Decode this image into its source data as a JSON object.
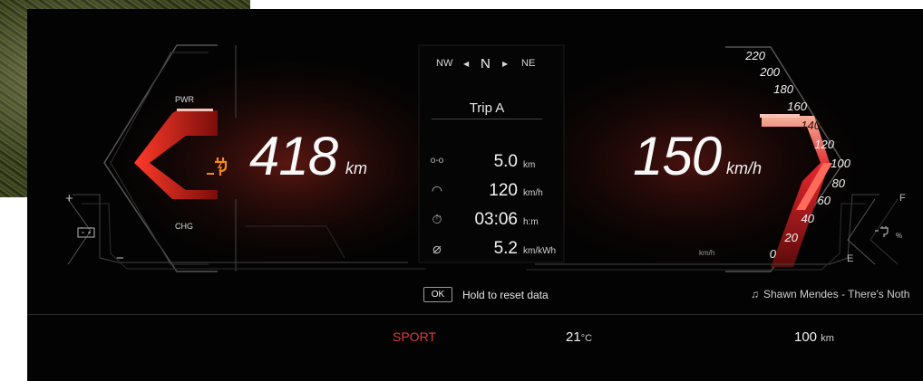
{
  "compass": {
    "left": "NW",
    "left_arrow": "◀",
    "heading": "N",
    "right_arrow": "▶",
    "right": "NE"
  },
  "trip": {
    "title": "Trip A",
    "rows": [
      {
        "icon": "distance-icon",
        "glyph": "o-o",
        "value": "5.0",
        "unit": "km"
      },
      {
        "icon": "speedometer-icon",
        "glyph": "◠",
        "value": "120",
        "unit": "km/h"
      },
      {
        "icon": "stopwatch-icon",
        "glyph": "⏱",
        "value": "03:06",
        "unit": "h:m"
      },
      {
        "icon": "consumption-icon",
        "glyph": "⌀",
        "value": "5.2",
        "unit": "km/kWh"
      }
    ]
  },
  "range": {
    "value": "418",
    "unit": "km"
  },
  "speed": {
    "value": "150",
    "unit": "km/h",
    "gauge_unit": "km/h"
  },
  "power_gauge": {
    "top_label": "PWR",
    "bottom_label": "CHG",
    "plus": "+",
    "minus": "−"
  },
  "speed_ticks": [
    "220",
    "200",
    "180",
    "160",
    "140",
    "120",
    "100",
    "80",
    "60",
    "40",
    "20",
    "0"
  ],
  "charge_gauge": {
    "full": "F",
    "empty": "E",
    "unit": "%"
  },
  "reset": {
    "button": "OK",
    "hint": "Hold to reset data"
  },
  "media": {
    "glyph": "♫",
    "track": "Shawn Mendes - There's Noth"
  },
  "status_bar": {
    "mode": "SPORT",
    "temp_value": "21",
    "temp_unit": "°C",
    "range_value": "100",
    "range_unit": "km"
  },
  "colors": {
    "accent_red": "#e0252b",
    "charge_orange": "#f08a1c",
    "background": "#030303"
  }
}
